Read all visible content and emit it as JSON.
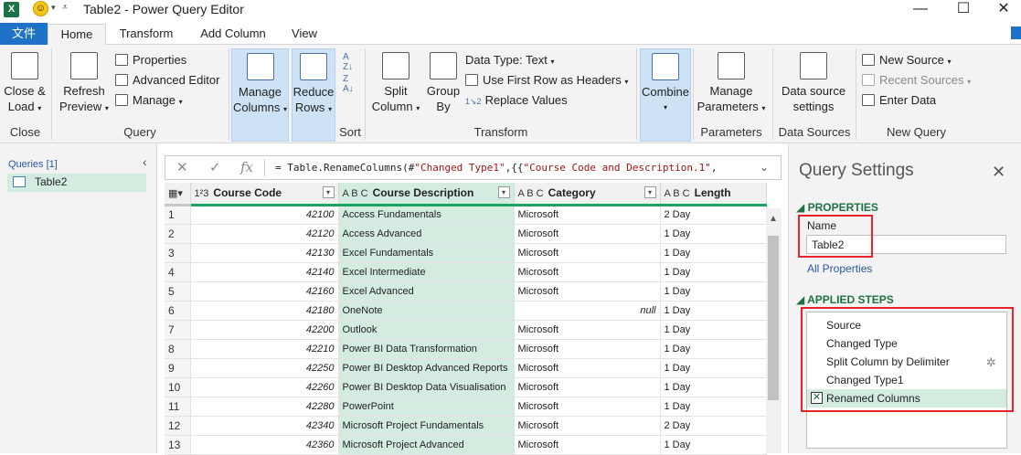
{
  "window": {
    "title": "Table2 - Power Query Editor",
    "app_icon": "excel-icon",
    "minimize": "—",
    "maximize": "☐",
    "close": "✕"
  },
  "tabs": {
    "file": "文件",
    "items": [
      "Home",
      "Transform",
      "Add Column",
      "View"
    ],
    "active": "Home"
  },
  "ribbon": {
    "close_load": [
      "Close &",
      "Load"
    ],
    "close_group": "Close",
    "refresh": [
      "Refresh",
      "Preview"
    ],
    "properties": "Properties",
    "advanced_editor": "Advanced Editor",
    "manage": "Manage",
    "query_group": "Query",
    "manage_columns": [
      "Manage",
      "Columns"
    ],
    "reduce_rows": [
      "Reduce",
      "Rows"
    ],
    "sort_group": "Sort",
    "split_column": [
      "Split",
      "Column"
    ],
    "group_by": [
      "Group",
      "By"
    ],
    "data_type": "Data Type: Text",
    "first_row_headers": "Use First Row as Headers",
    "replace_values": "Replace Values",
    "transform_group": "Transform",
    "combine": "Combine",
    "manage_parameters": [
      "Manage",
      "Parameters"
    ],
    "parameters_group": "Parameters",
    "data_source_settings": [
      "Data source",
      "settings"
    ],
    "data_sources_group": "Data Sources",
    "new_source": "New Source",
    "recent_sources": "Recent Sources",
    "enter_data": "Enter Data",
    "new_query_group": "New Query"
  },
  "queries_pane": {
    "header": "Queries [1]",
    "items": [
      "Table2"
    ]
  },
  "formula": {
    "prefix": "= Table.RenameColumns(#",
    "str1": "\"Changed Type1\"",
    "mid": ",{{",
    "str2": "\"Course Code and Description.1\"",
    "suffix": ","
  },
  "grid": {
    "columns": [
      {
        "type": "1²3",
        "name": "Course Code"
      },
      {
        "type": "A B C",
        "name": "Course Description"
      },
      {
        "type": "A B C",
        "name": "Category"
      },
      {
        "type": "A B C",
        "name": "Length"
      }
    ],
    "rows": [
      [
        "1",
        "42100",
        "Access Fundamentals",
        "Microsoft",
        "2 Day"
      ],
      [
        "2",
        "42120",
        "Access Advanced",
        "Microsoft",
        "1 Day"
      ],
      [
        "3",
        "42130",
        "Excel Fundamentals",
        "Microsoft",
        "1 Day"
      ],
      [
        "4",
        "42140",
        "Excel Intermediate",
        "Microsoft",
        "1 Day"
      ],
      [
        "5",
        "42160",
        "Excel Advanced",
        "Microsoft",
        "1 Day"
      ],
      [
        "6",
        "42180",
        "OneNote",
        "null",
        "1 Day"
      ],
      [
        "7",
        "42200",
        "Outlook",
        "Microsoft",
        "1 Day"
      ],
      [
        "8",
        "42210",
        "Power BI Data Transformation",
        "Microsoft",
        "1 Day"
      ],
      [
        "9",
        "42250",
        "Power BI Desktop Advanced Reports",
        "Microsoft",
        "1 Day"
      ],
      [
        "10",
        "42260",
        "Power BI Desktop Data Visualisation",
        "Microsoft",
        "1 Day"
      ],
      [
        "11",
        "42280",
        "PowerPoint",
        "Microsoft",
        "1 Day"
      ],
      [
        "12",
        "42340",
        "Microsoft Project Fundamentals",
        "Microsoft",
        "2 Day"
      ],
      [
        "13",
        "42360",
        "Microsoft Project Advanced",
        "Microsoft",
        "1 Day"
      ]
    ]
  },
  "settings": {
    "title": "Query Settings",
    "properties_header": "PROPERTIES",
    "name_label": "Name",
    "name_value": "Table2",
    "all_properties": "All Properties",
    "applied_steps_header": "APPLIED STEPS",
    "steps": [
      "Source",
      "Changed Type",
      "Split Column by Delimiter",
      "Changed Type1",
      "Renamed Columns"
    ],
    "active_step": "Renamed Columns"
  },
  "colors": {
    "accent_green": "#1e7145",
    "file_tab_blue": "#1e72c8",
    "highlight_red": "#e8212b",
    "selected_column": "#d4ecdf"
  }
}
